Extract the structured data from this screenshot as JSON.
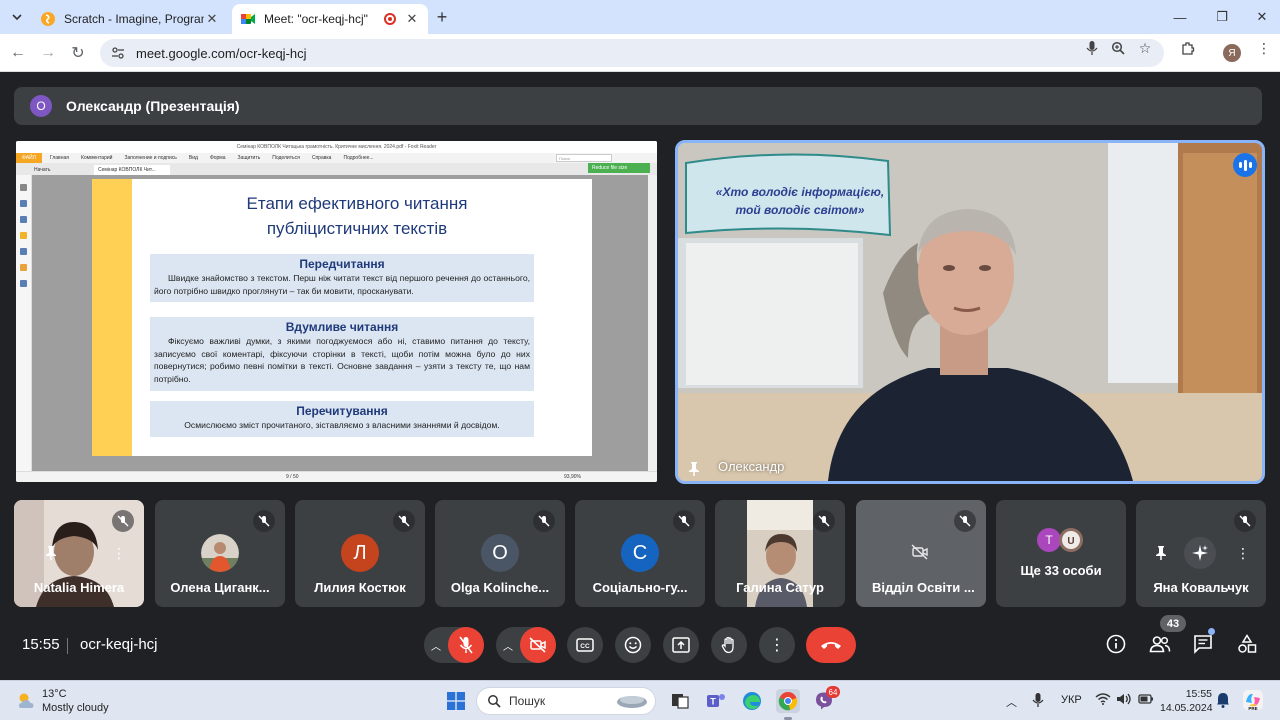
{
  "browser": {
    "tabs": [
      {
        "title": "Scratch - Imagine, Program, Sh",
        "active": false
      },
      {
        "title": "Meet: \"ocr-keqj-hcj\"",
        "active": true
      }
    ],
    "url": "meet.google.com/ocr-keqj-hcj",
    "profile_initial": "Я"
  },
  "meet": {
    "presenter_initial": "О",
    "presenter_label": "Олександр (Презентація)",
    "speaker_name": "Олександр",
    "clock": "15:55",
    "meeting_code": "ocr-keqj-hcj",
    "people_count": "43"
  },
  "shared_screen": {
    "window_title": "Семінар КОВПОЛК Читацька грамотність. Критичне мислення. 2024.pdf - Foxit Reader",
    "ribbon_file": "ФАЙЛ",
    "ribbon": [
      "Главная",
      "Комментарий",
      "Заполнение и подпись",
      "Вид",
      "Форма",
      "Защитить",
      "Поделиться",
      "Справка",
      "Подробнее..."
    ],
    "search_placeholder": "Поиск",
    "tab_start": "Начать",
    "tab_doc": "Семінар КОВПОЛК Чит...",
    "reduce_button": "Reduce file size",
    "page_indicator": "9 / 50",
    "zoom": "93,90%",
    "slide": {
      "title_line1": "Етапи ефективного читання",
      "title_line2": "публіцистичних текстів",
      "section1_title": "Передчитання",
      "section1_text": "Швидке знайомство з текстом. Перш ніж читати текст від першого речення до останнього, його потрібно швидко проглянути – так би мовити, просканувати.",
      "section2_title": "Вдумливе читання",
      "section2_text": "Фіксуємо важливі думки, з якими погоджуємося або ні, ставимо питання до тексту, записуємо свої коментарі, фіксуючи сторінки в тексті, щоби потім можна було до них повернутися; робимо певні помітки в тексті. Основне завдання – узяти з тексту те, що нам потрібно.",
      "section3_title": "Перечитування",
      "section3_text": "Осмислюємо зміст прочитаного, зіставляємо з власними знаннями й досвідом."
    }
  },
  "classroom_banner": {
    "line1": "«Хто володіє інформацією,",
    "line2": "той володіє",
    "line3": "світом»"
  },
  "participants": [
    {
      "name": "Natalia Himera",
      "kind": "video"
    },
    {
      "name": "Олена Циганк...",
      "kind": "photo"
    },
    {
      "name": "Лилия Костюк",
      "kind": "avatar",
      "initial": "Л",
      "color": "#c5441e"
    },
    {
      "name": "Olga Kolinche...",
      "kind": "avatar",
      "initial": "O",
      "color": "#4a5566"
    },
    {
      "name": "Соціально-гу...",
      "kind": "avatar",
      "initial": "C",
      "color": "#1565c0"
    },
    {
      "name": "Галина Сатур",
      "kind": "video"
    },
    {
      "name": "Відділ Освіти ...",
      "kind": "camera-off"
    },
    {
      "name": "Ще 33 особи",
      "kind": "more",
      "initial": "T"
    },
    {
      "name": "Яна Ковальчук",
      "kind": "hover"
    }
  ],
  "taskbar": {
    "temperature": "13°C",
    "weather": "Mostly cloudy",
    "search_label": "Пошук",
    "language": "УКР",
    "time": "15:55",
    "date": "14.05.2024",
    "notif_count": "64",
    "tray_badge": "PRE"
  },
  "colors": {
    "meet_bg": "#202124",
    "tile_bg": "#3c4043",
    "end_call": "#ea4335",
    "speaker_border": "#8ab4f8",
    "accent_blue": "#1a73e8"
  }
}
